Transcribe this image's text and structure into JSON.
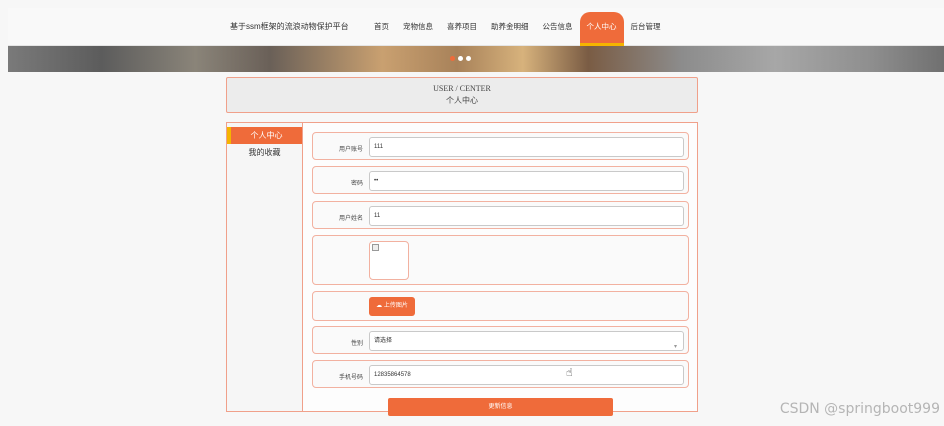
{
  "app": {
    "brand": "基于ssm框架的流浪动物保护平台"
  },
  "nav": {
    "items": [
      {
        "label": "首页"
      },
      {
        "label": "宠物信息"
      },
      {
        "label": "喜养项目"
      },
      {
        "label": "助养金明细"
      },
      {
        "label": "公告信息"
      },
      {
        "label": "个人中心"
      },
      {
        "label": "后台管理"
      }
    ],
    "active": "个人中心"
  },
  "banner": {
    "carousel_count": 3,
    "active_index": 0
  },
  "center_header": {
    "title_en": "USER / CENTER",
    "title_cn": "个人中心"
  },
  "sidebar": {
    "items": [
      {
        "label": "个人中心"
      },
      {
        "label": "我的收藏"
      }
    ]
  },
  "form": {
    "account": {
      "label": "用户账号",
      "value": "111"
    },
    "password": {
      "label": "密码",
      "value": "••"
    },
    "name": {
      "label": "用户姓名",
      "value": "11"
    },
    "upload": {
      "label": "上传图片",
      "icon": "cloud-upload-icon"
    },
    "gender": {
      "label": "性别",
      "placeholder": "请选择"
    },
    "phone": {
      "label": "手机号码",
      "value": "12835864578"
    },
    "submit_label": "更新信息"
  },
  "colors": {
    "accent": "#ef6b3a",
    "highlight": "#f5b400",
    "border": "#f0a08a"
  },
  "watermark": "CSDN @springboot999"
}
